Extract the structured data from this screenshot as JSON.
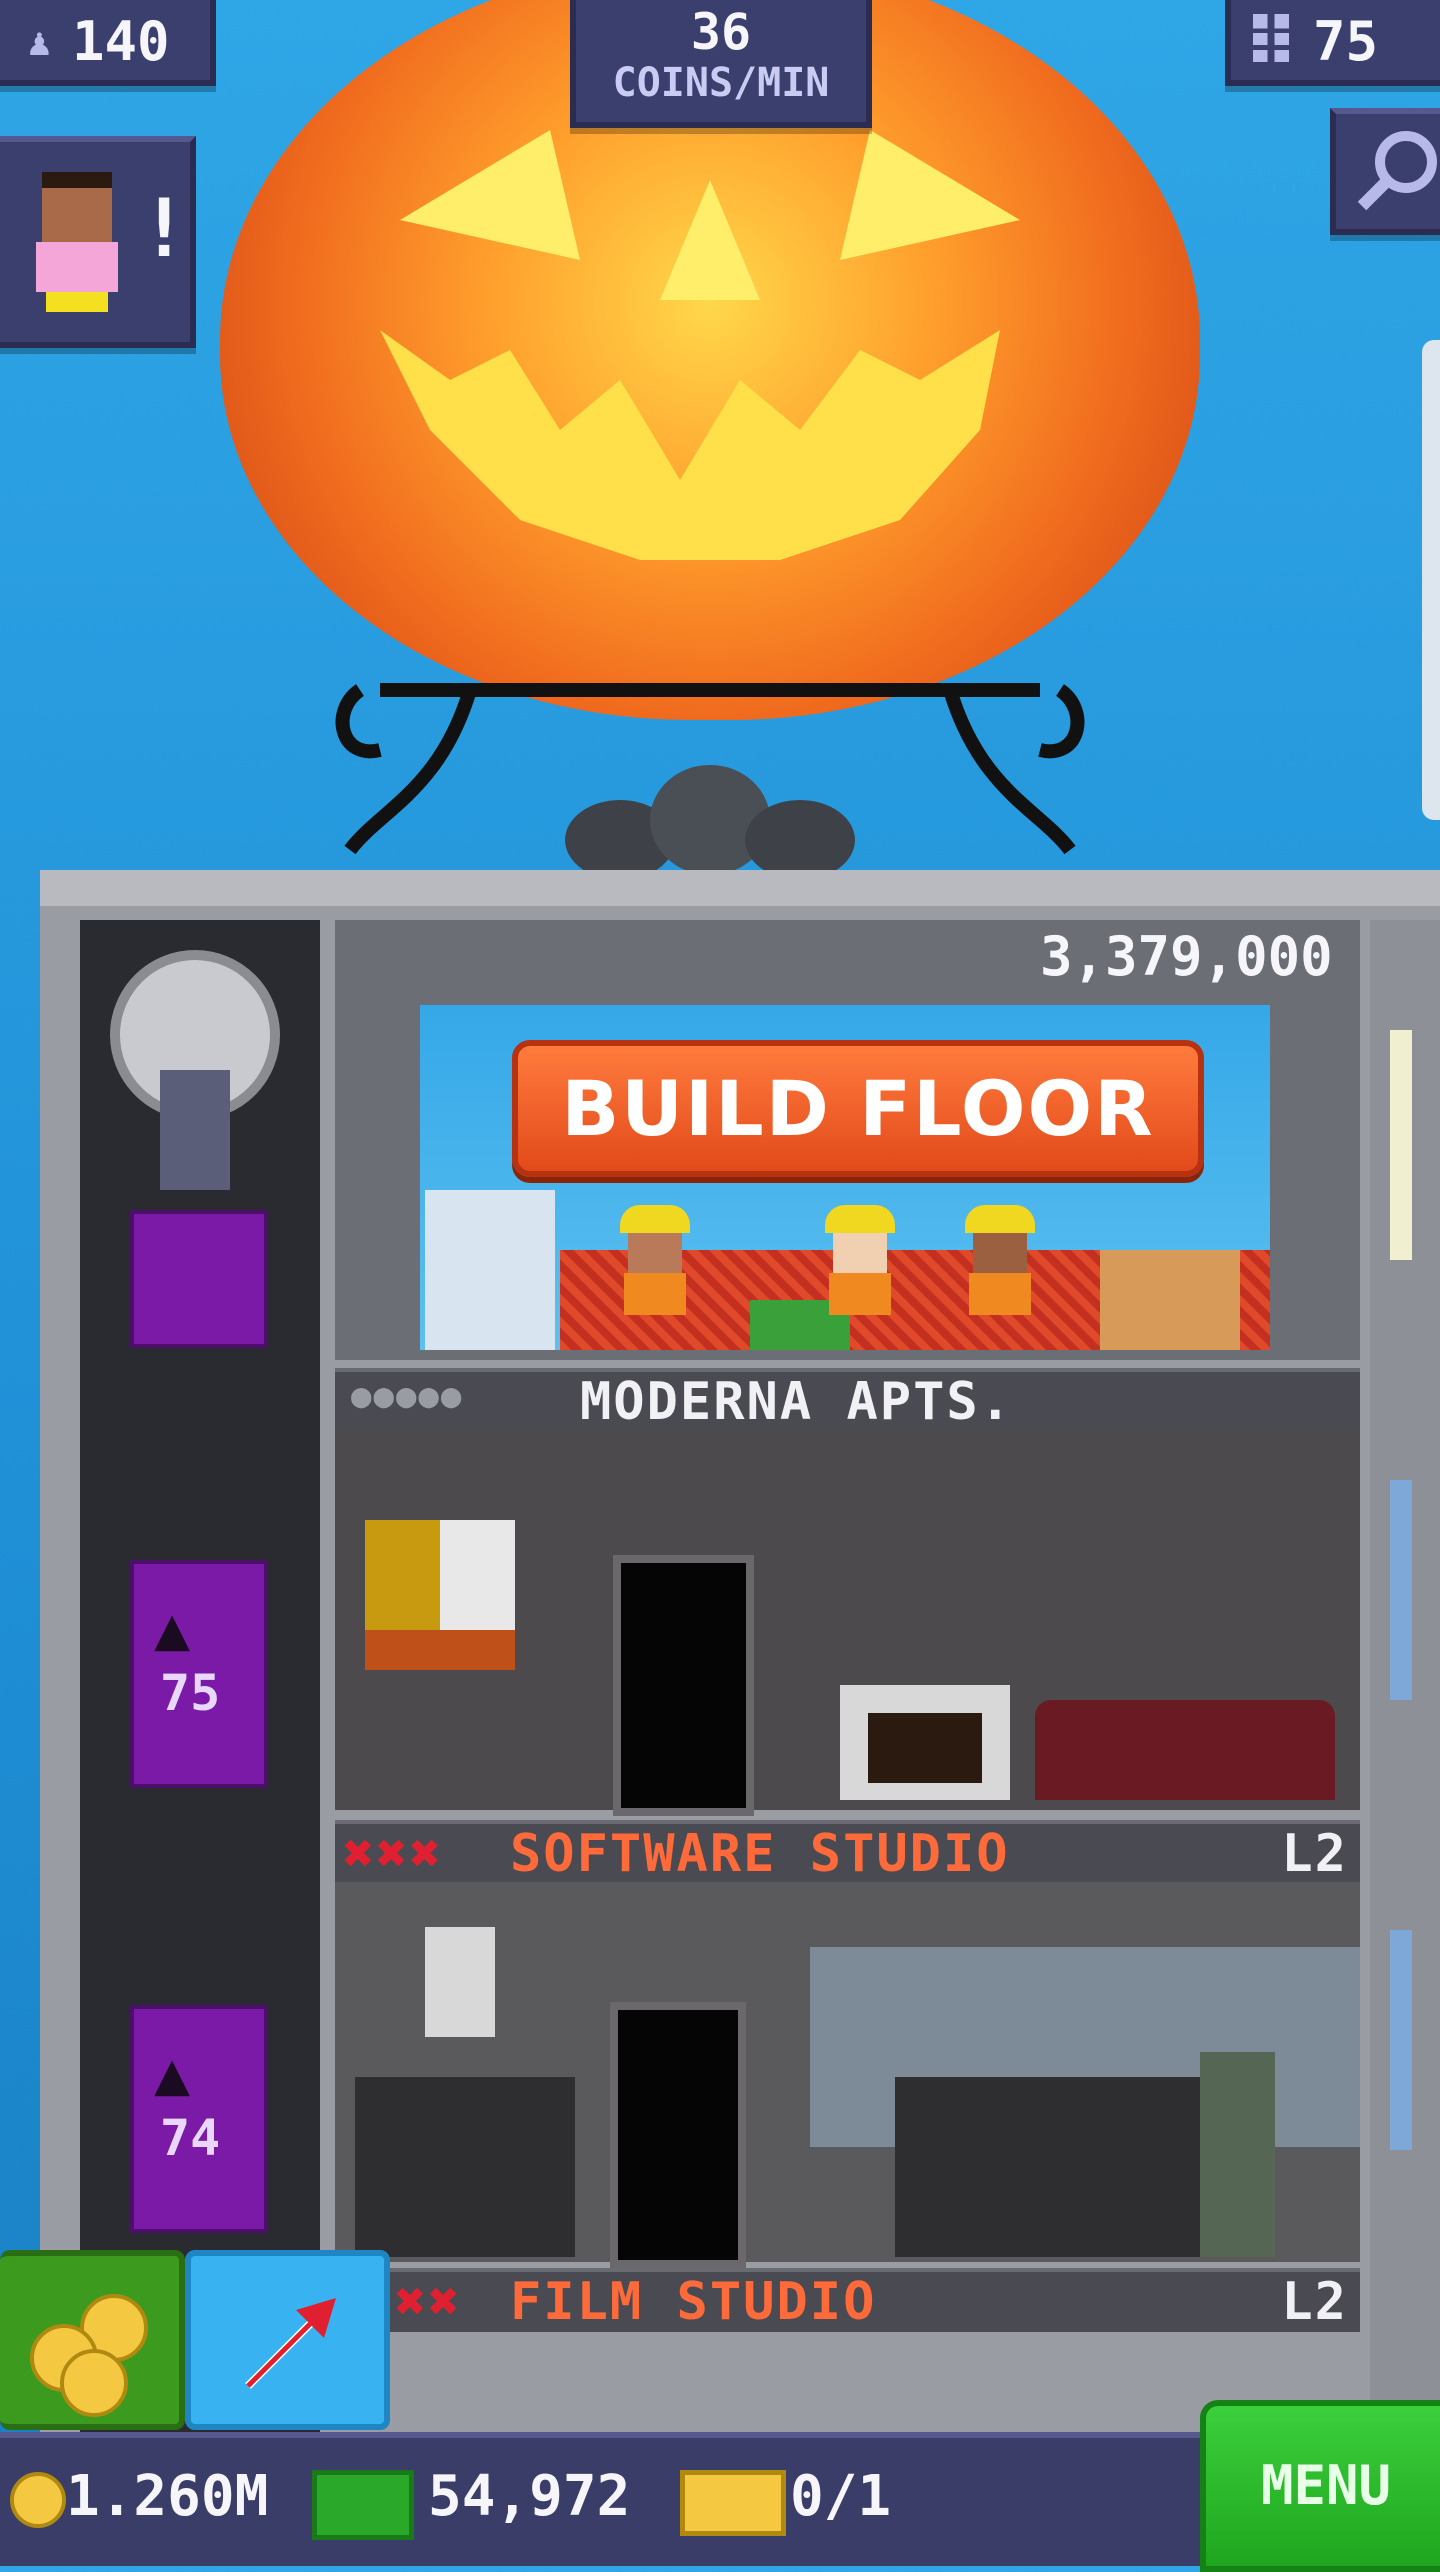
{
  "hud": {
    "population": "140",
    "coins_per_min_value": "36",
    "coins_per_min_label": "COINS/MIN",
    "floors": "75"
  },
  "build_panel": {
    "cost": "3,379,000",
    "button_label": "BUILD FLOOR",
    "floor_name": "MODERNA APTS."
  },
  "floors_list": [
    {
      "name": "SOFTWARE STUDIO",
      "level": "L2",
      "floor_number": "75",
      "marks": 3
    },
    {
      "name": "FILM STUDIO",
      "level": "L2",
      "floor_number": "74",
      "marks": 2
    }
  ],
  "bottom_bar": {
    "coins": "1.260M",
    "bux": "54,972",
    "tickets": "0/1",
    "menu_label": "MENU"
  },
  "colors": {
    "hud_bg": "#3b3f6e",
    "build_button": "#ef5a22",
    "floor_name_text": "#ff6a3a",
    "menu_green": "#2fbf2f",
    "elevator_purple": "#7a1aa6",
    "sky": "#2fa6e6"
  },
  "icons": [
    "population-icon",
    "building-icon",
    "zoom-out-icon",
    "notification-icon",
    "coin-icon",
    "bux-icon",
    "ticket-icon",
    "coin-stack-icon",
    "move-arrow-icon",
    "bat-icon"
  ]
}
